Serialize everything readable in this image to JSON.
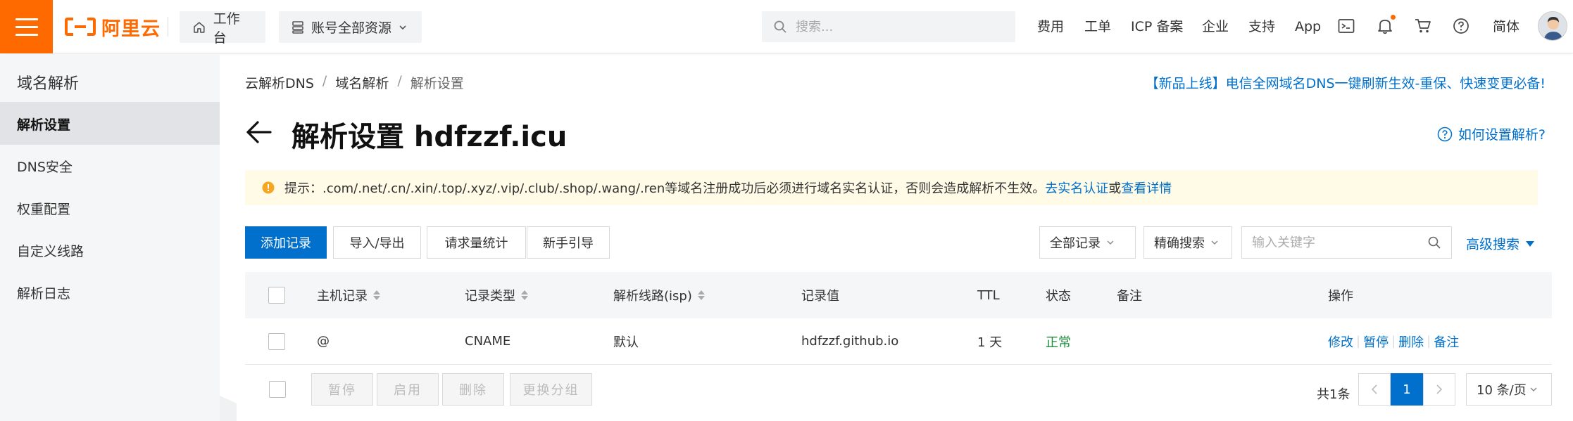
{
  "header": {
    "logo_text": "阿里云",
    "workbench_label": "工作台",
    "resources_label": "账号全部资源",
    "search_placeholder": "搜索...",
    "links": {
      "fees": "费用",
      "tickets": "工单",
      "icp": "ICP 备案",
      "enterprise": "企业",
      "support": "支持",
      "app": "App",
      "language": "简体"
    },
    "accent_color": "#ff6a00"
  },
  "sidebar": {
    "title": "域名解析",
    "items": [
      {
        "label": "解析设置",
        "active": true
      },
      {
        "label": "DNS安全",
        "active": false
      },
      {
        "label": "权重配置",
        "active": false
      },
      {
        "label": "自定义线路",
        "active": false
      },
      {
        "label": "解析日志",
        "active": false
      }
    ]
  },
  "breadcrumb": [
    "云解析DNS",
    "域名解析",
    "解析设置"
  ],
  "breadcrumb_sep": "/",
  "promo_text": "【新品上线】电信全网域名DNS一键刷新生效-重保、快速变更必备!",
  "page": {
    "title": "解析设置 hdfzzf.icu",
    "howto": "如何设置解析?"
  },
  "tip": {
    "text": "提示：.com/.net/.cn/.xin/.top/.xyz/.vip/.club/.shop/.wang/.ren等域名注册成功后必须进行域名实名认证，否则会造成解析不生效。",
    "link1": "去实名认证",
    "or": "或",
    "link2": "查看详情"
  },
  "toolbar": {
    "add_record": "添加记录",
    "import_export": "导入/导出",
    "request_stats": "请求量统计",
    "guide": "新手引导",
    "filter_all": "全部记录",
    "filter_exact": "精确搜索",
    "keyword_placeholder": "输入关键字",
    "advanced_search": "高级搜索"
  },
  "table": {
    "columns": {
      "host": "主机记录",
      "type": "记录类型",
      "line": "解析线路(isp)",
      "value": "记录值",
      "ttl": "TTL",
      "status": "状态",
      "remark": "备注",
      "actions": "操作"
    },
    "rows": [
      {
        "host": "@",
        "type": "CNAME",
        "line": "默认",
        "value": "hdfzzf.github.io",
        "ttl": "1 天",
        "status": "正常",
        "remark": "",
        "actions": [
          "修改",
          "暂停",
          "删除",
          "备注"
        ]
      }
    ]
  },
  "footer": {
    "pause": "暂停",
    "enable": "启用",
    "delete": "删除",
    "change_group": "更换分组",
    "total": "共1条",
    "current_page": "1",
    "page_size": "10 条/页"
  }
}
